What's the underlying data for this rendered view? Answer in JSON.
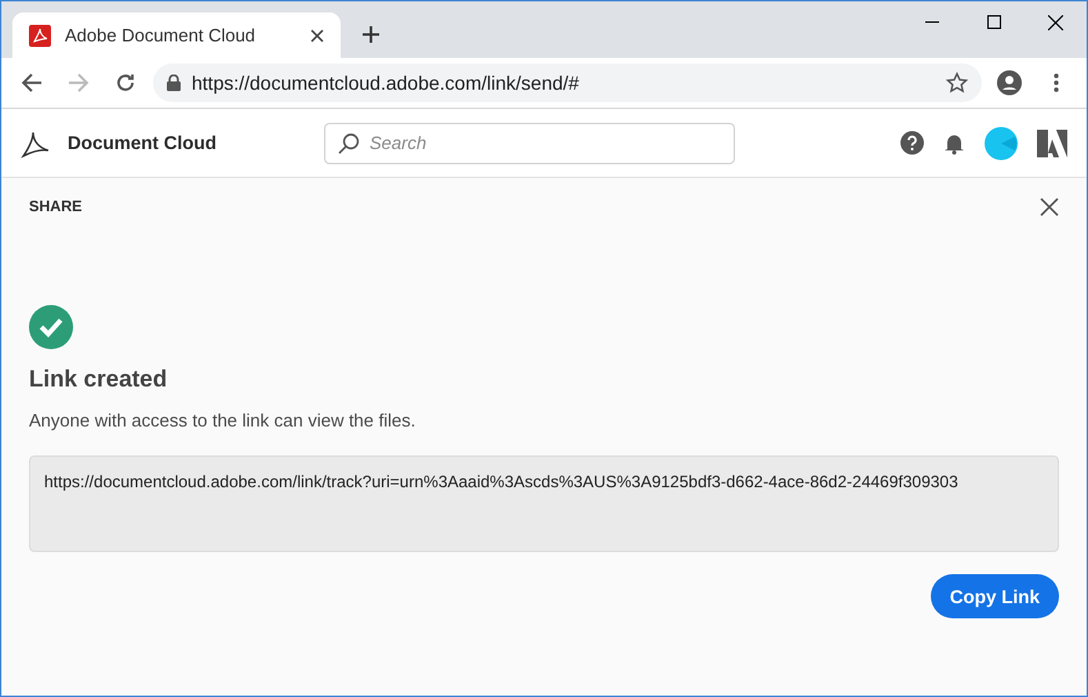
{
  "browser": {
    "tab_title": "Adobe Document Cloud",
    "address": "https://documentcloud.adobe.com/link/send/#"
  },
  "app_header": {
    "brand": "Document Cloud",
    "search": {
      "placeholder": "Search"
    }
  },
  "share": {
    "title": "SHARE",
    "heading": "Link created",
    "message": "Anyone with access to the link can view the files.",
    "link": "https://documentcloud.adobe.com/link/track?uri=urn%3Aaaid%3Ascds%3AUS%3A9125bdf3-d662-4ace-86d2-24469f309303",
    "button": "Copy Link"
  }
}
